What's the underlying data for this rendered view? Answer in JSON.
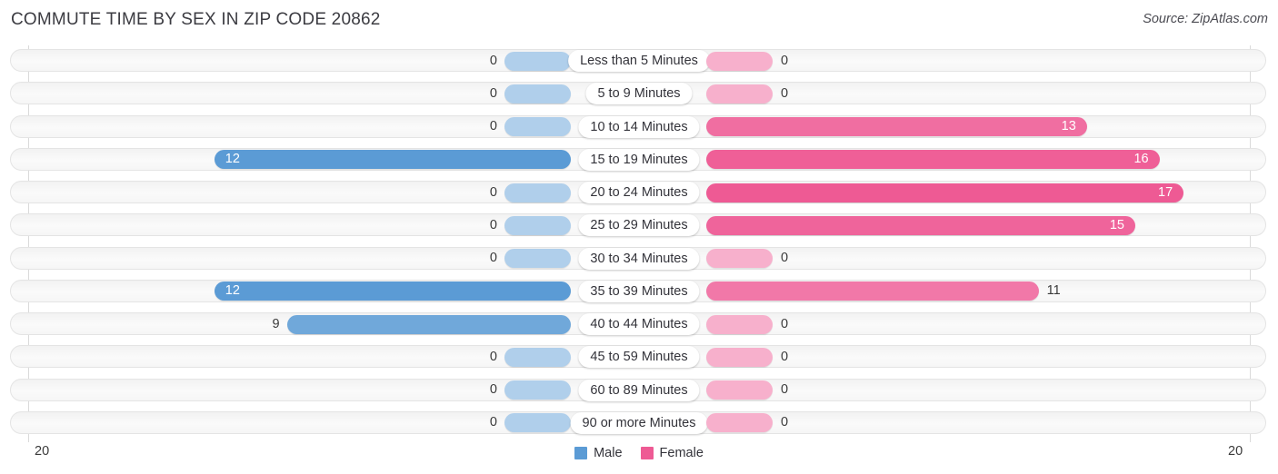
{
  "header": {
    "title": "COMMUTE TIME BY SEX IN ZIP CODE 20862",
    "source": "Source: ZipAtlas.com"
  },
  "axis": {
    "left_label": "20",
    "right_label": "20"
  },
  "legend": {
    "items": [
      {
        "label": "Male",
        "color": "#5b9bd5"
      },
      {
        "label": "Female",
        "color": "#ee5a94"
      }
    ]
  },
  "chart_data": {
    "type": "bar",
    "orientation": "horizontal-diverging",
    "title": "COMMUTE TIME BY SEX IN ZIP CODE 20862",
    "subtitle": "",
    "xlabel": "",
    "ylabel": "",
    "axis_max": 20,
    "xlim": [
      20,
      0,
      20
    ],
    "grid": false,
    "legend_position": "bottom-center",
    "source": "Source: ZipAtlas.com",
    "categories": [
      "Less than 5 Minutes",
      "5 to 9 Minutes",
      "10 to 14 Minutes",
      "15 to 19 Minutes",
      "20 to 24 Minutes",
      "25 to 29 Minutes",
      "30 to 34 Minutes",
      "35 to 39 Minutes",
      "40 to 44 Minutes",
      "45 to 59 Minutes",
      "60 to 89 Minutes",
      "90 or more Minutes"
    ],
    "series": [
      {
        "name": "Male",
        "side": "left",
        "color": "#5b9bd5",
        "values": [
          0,
          0,
          0,
          12,
          0,
          0,
          0,
          12,
          9,
          0,
          0,
          0
        ]
      },
      {
        "name": "Female",
        "side": "right",
        "color": "#ee5a94",
        "values": [
          0,
          0,
          13,
          16,
          17,
          15,
          0,
          11,
          0,
          0,
          0,
          0
        ]
      }
    ]
  }
}
